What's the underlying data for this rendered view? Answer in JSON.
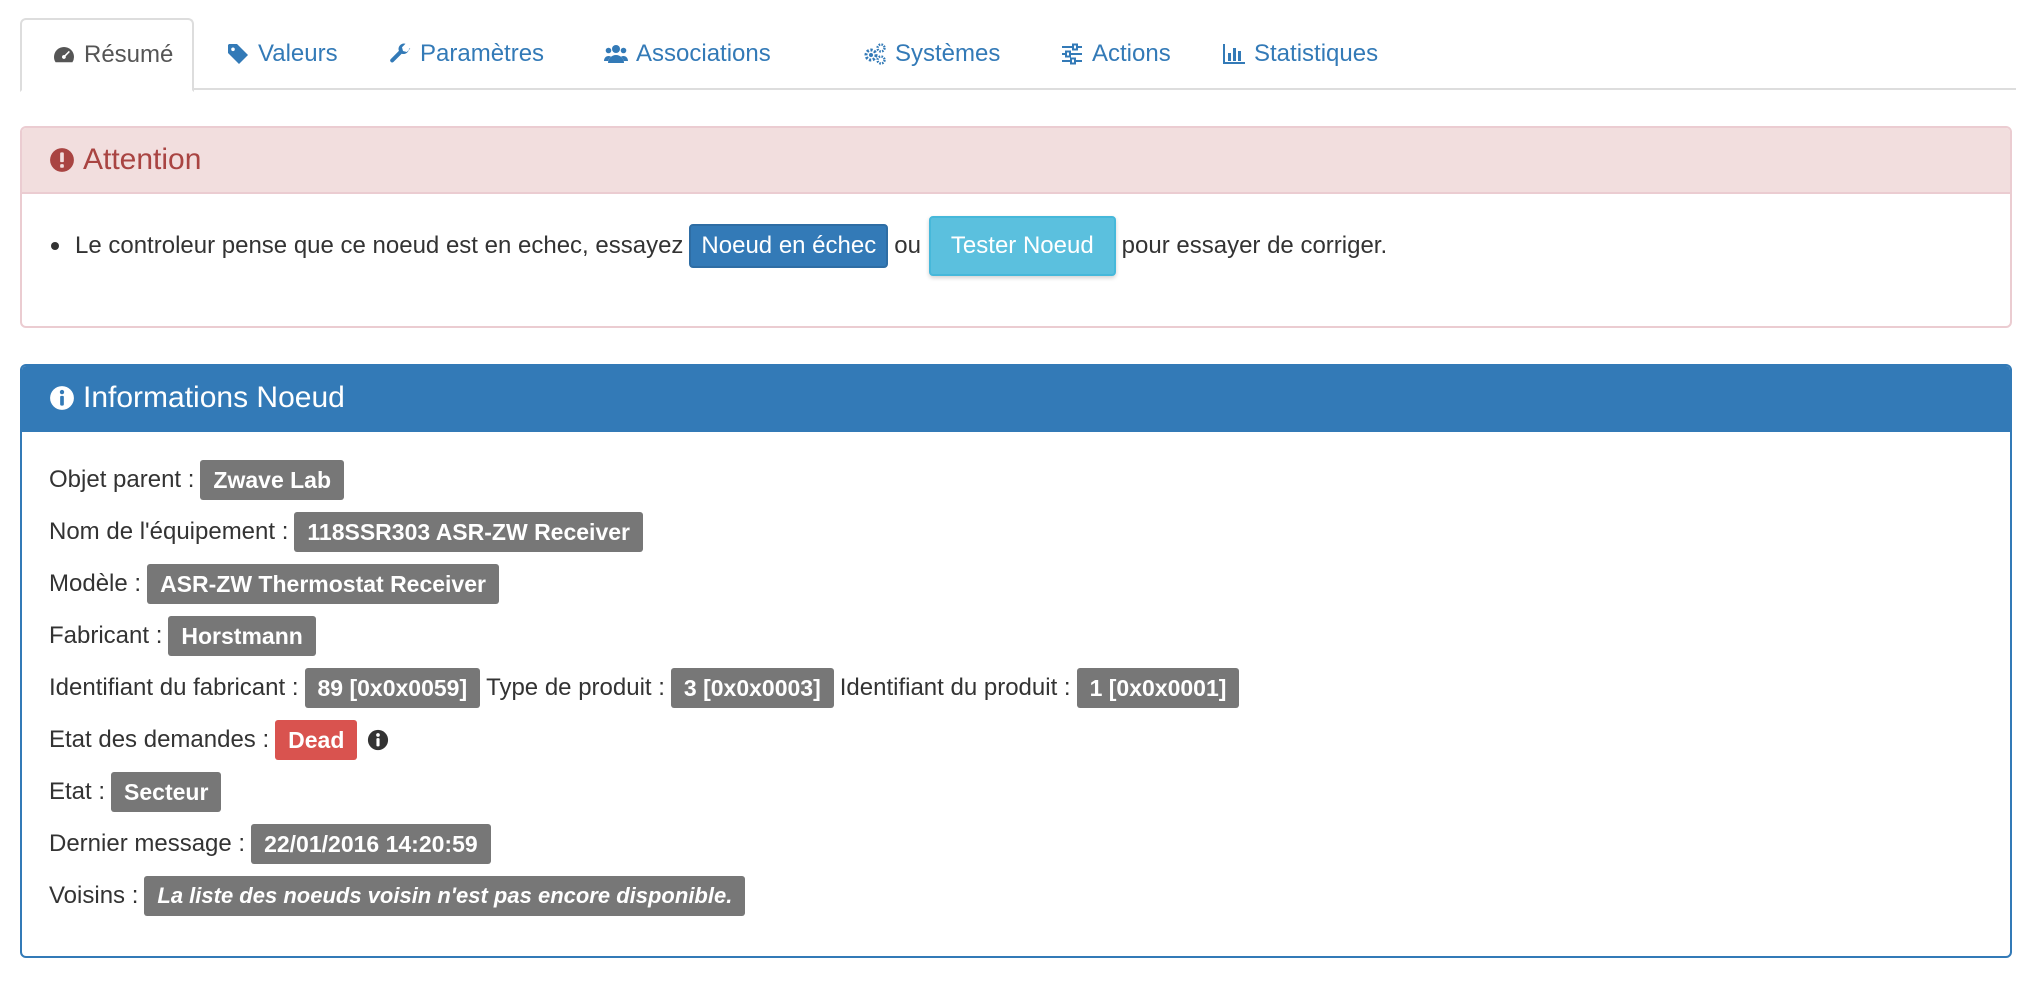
{
  "tabs": [
    {
      "label": "Résumé",
      "icon": "dashboard-icon",
      "active": true
    },
    {
      "label": "Valeurs",
      "icon": "tag-icon"
    },
    {
      "label": "Paramètres",
      "icon": "wrench-icon"
    },
    {
      "label": "Associations",
      "icon": "users-icon"
    },
    {
      "label": "Systèmes",
      "icon": "gears-icon"
    },
    {
      "label": "Actions",
      "icon": "sliders-icon"
    },
    {
      "label": "Statistiques",
      "icon": "bar-chart-icon"
    }
  ],
  "alert": {
    "title": "Attention",
    "text_before": "Le controleur pense que ce noeud est en echec, essayez",
    "button_failed": "Noeud en échec",
    "text_or": "ou",
    "button_test": "Tester Noeud",
    "text_after": "pour essayer de corriger."
  },
  "info": {
    "title": "Informations Noeud",
    "parent_label": "Objet parent :",
    "parent_value": "Zwave Lab",
    "equipment_label": "Nom de l'équipement :",
    "equipment_value": "118SSR303 ASR-ZW Receiver",
    "model_label": "Modèle :",
    "model_value": "ASR-ZW Thermostat Receiver",
    "manufacturer_label": "Fabricant :",
    "manufacturer_value": "Horstmann",
    "manufacturer_id_label": "Identifiant du fabricant :",
    "manufacturer_id_value": "89 [0x0x0059]",
    "product_type_label": "Type de produit :",
    "product_type_value": "3 [0x0x0003]",
    "product_id_label": "Identifiant du produit :",
    "product_id_value": "1 [0x0x0001]",
    "query_state_label": "Etat des demandes :",
    "query_state_value": "Dead",
    "state_label": "Etat :",
    "state_value": "Secteur",
    "last_message_label": "Dernier message :",
    "last_message_value": "22/01/2016 14:20:59",
    "neighbors_label": "Voisins :",
    "neighbors_value": "La liste des noeuds voisin n'est pas encore disponible."
  },
  "colors": {
    "link": "#337ab7",
    "danger_bg": "#f2dede",
    "danger_text": "#a94442",
    "primary": "#337ab7",
    "info": "#5bc0de",
    "label_default": "#777777",
    "label_danger": "#d9534f"
  }
}
